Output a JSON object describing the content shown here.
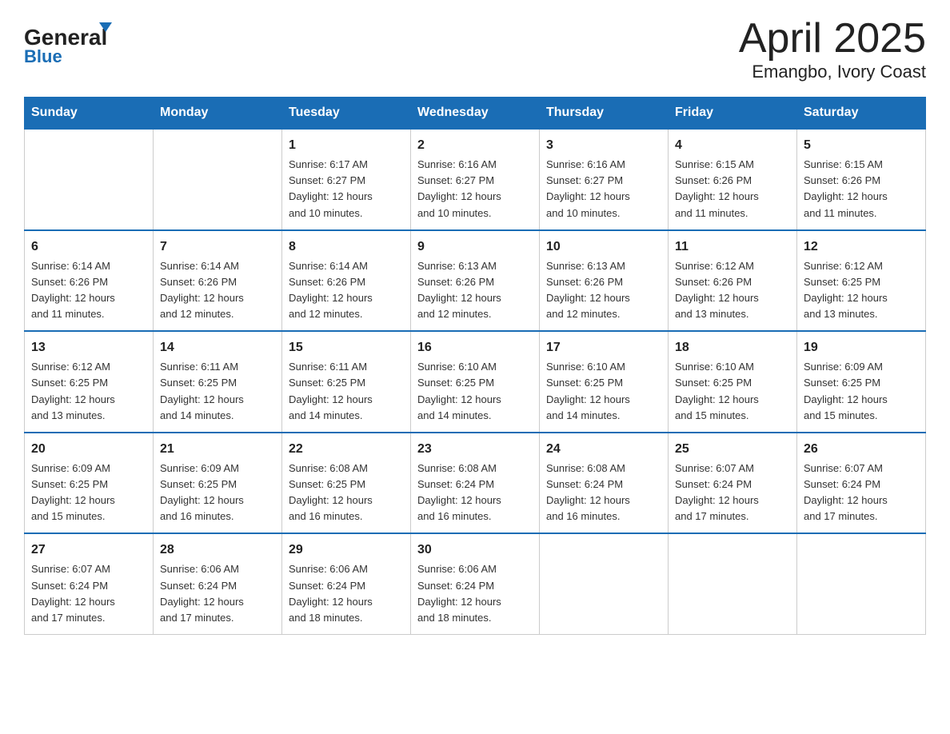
{
  "header": {
    "logo_line1": "General",
    "logo_line2": "Blue",
    "title": "April 2025",
    "subtitle": "Emangbo, Ivory Coast"
  },
  "calendar": {
    "days_of_week": [
      "Sunday",
      "Monday",
      "Tuesday",
      "Wednesday",
      "Thursday",
      "Friday",
      "Saturday"
    ],
    "weeks": [
      [
        {
          "day": "",
          "info": ""
        },
        {
          "day": "",
          "info": ""
        },
        {
          "day": "1",
          "info": "Sunrise: 6:17 AM\nSunset: 6:27 PM\nDaylight: 12 hours\nand 10 minutes."
        },
        {
          "day": "2",
          "info": "Sunrise: 6:16 AM\nSunset: 6:27 PM\nDaylight: 12 hours\nand 10 minutes."
        },
        {
          "day": "3",
          "info": "Sunrise: 6:16 AM\nSunset: 6:27 PM\nDaylight: 12 hours\nand 10 minutes."
        },
        {
          "day": "4",
          "info": "Sunrise: 6:15 AM\nSunset: 6:26 PM\nDaylight: 12 hours\nand 11 minutes."
        },
        {
          "day": "5",
          "info": "Sunrise: 6:15 AM\nSunset: 6:26 PM\nDaylight: 12 hours\nand 11 minutes."
        }
      ],
      [
        {
          "day": "6",
          "info": "Sunrise: 6:14 AM\nSunset: 6:26 PM\nDaylight: 12 hours\nand 11 minutes."
        },
        {
          "day": "7",
          "info": "Sunrise: 6:14 AM\nSunset: 6:26 PM\nDaylight: 12 hours\nand 12 minutes."
        },
        {
          "day": "8",
          "info": "Sunrise: 6:14 AM\nSunset: 6:26 PM\nDaylight: 12 hours\nand 12 minutes."
        },
        {
          "day": "9",
          "info": "Sunrise: 6:13 AM\nSunset: 6:26 PM\nDaylight: 12 hours\nand 12 minutes."
        },
        {
          "day": "10",
          "info": "Sunrise: 6:13 AM\nSunset: 6:26 PM\nDaylight: 12 hours\nand 12 minutes."
        },
        {
          "day": "11",
          "info": "Sunrise: 6:12 AM\nSunset: 6:26 PM\nDaylight: 12 hours\nand 13 minutes."
        },
        {
          "day": "12",
          "info": "Sunrise: 6:12 AM\nSunset: 6:25 PM\nDaylight: 12 hours\nand 13 minutes."
        }
      ],
      [
        {
          "day": "13",
          "info": "Sunrise: 6:12 AM\nSunset: 6:25 PM\nDaylight: 12 hours\nand 13 minutes."
        },
        {
          "day": "14",
          "info": "Sunrise: 6:11 AM\nSunset: 6:25 PM\nDaylight: 12 hours\nand 14 minutes."
        },
        {
          "day": "15",
          "info": "Sunrise: 6:11 AM\nSunset: 6:25 PM\nDaylight: 12 hours\nand 14 minutes."
        },
        {
          "day": "16",
          "info": "Sunrise: 6:10 AM\nSunset: 6:25 PM\nDaylight: 12 hours\nand 14 minutes."
        },
        {
          "day": "17",
          "info": "Sunrise: 6:10 AM\nSunset: 6:25 PM\nDaylight: 12 hours\nand 14 minutes."
        },
        {
          "day": "18",
          "info": "Sunrise: 6:10 AM\nSunset: 6:25 PM\nDaylight: 12 hours\nand 15 minutes."
        },
        {
          "day": "19",
          "info": "Sunrise: 6:09 AM\nSunset: 6:25 PM\nDaylight: 12 hours\nand 15 minutes."
        }
      ],
      [
        {
          "day": "20",
          "info": "Sunrise: 6:09 AM\nSunset: 6:25 PM\nDaylight: 12 hours\nand 15 minutes."
        },
        {
          "day": "21",
          "info": "Sunrise: 6:09 AM\nSunset: 6:25 PM\nDaylight: 12 hours\nand 16 minutes."
        },
        {
          "day": "22",
          "info": "Sunrise: 6:08 AM\nSunset: 6:25 PM\nDaylight: 12 hours\nand 16 minutes."
        },
        {
          "day": "23",
          "info": "Sunrise: 6:08 AM\nSunset: 6:24 PM\nDaylight: 12 hours\nand 16 minutes."
        },
        {
          "day": "24",
          "info": "Sunrise: 6:08 AM\nSunset: 6:24 PM\nDaylight: 12 hours\nand 16 minutes."
        },
        {
          "day": "25",
          "info": "Sunrise: 6:07 AM\nSunset: 6:24 PM\nDaylight: 12 hours\nand 17 minutes."
        },
        {
          "day": "26",
          "info": "Sunrise: 6:07 AM\nSunset: 6:24 PM\nDaylight: 12 hours\nand 17 minutes."
        }
      ],
      [
        {
          "day": "27",
          "info": "Sunrise: 6:07 AM\nSunset: 6:24 PM\nDaylight: 12 hours\nand 17 minutes."
        },
        {
          "day": "28",
          "info": "Sunrise: 6:06 AM\nSunset: 6:24 PM\nDaylight: 12 hours\nand 17 minutes."
        },
        {
          "day": "29",
          "info": "Sunrise: 6:06 AM\nSunset: 6:24 PM\nDaylight: 12 hours\nand 18 minutes."
        },
        {
          "day": "30",
          "info": "Sunrise: 6:06 AM\nSunset: 6:24 PM\nDaylight: 12 hours\nand 18 minutes."
        },
        {
          "day": "",
          "info": ""
        },
        {
          "day": "",
          "info": ""
        },
        {
          "day": "",
          "info": ""
        }
      ]
    ]
  }
}
